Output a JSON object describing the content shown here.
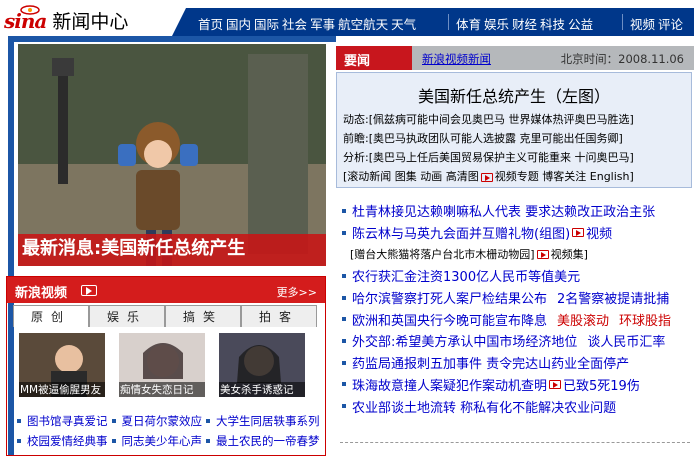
{
  "brand": {
    "logo": "sina",
    "section": "新闻中心"
  },
  "nav": {
    "group1": [
      "首页",
      "国内",
      "国际",
      "社会",
      "军事",
      "航空航天",
      "天气"
    ],
    "group2": [
      "体育",
      "娱乐",
      "财经",
      "科技",
      "公益"
    ],
    "group3": [
      "视频",
      "评论"
    ]
  },
  "hero": {
    "caption": "最新消息:美国新任总统产生"
  },
  "video": {
    "title": "新浪视频",
    "more": "更多>>",
    "tabs": [
      "原创",
      "娱乐",
      "搞笑",
      "拍客"
    ],
    "thumbs": [
      "MM被逼偷腥男友",
      "痴情女失恋日记",
      "美女杀手诱惑记"
    ],
    "links": [
      [
        "图书馆寻真爱记",
        "夏日荷尔蒙效应",
        "大学生同居轶事系列"
      ],
      [
        "校园爱情经典事",
        "同志美少年心声",
        "最土农民的一帝春梦"
      ]
    ]
  },
  "news_header": {
    "label": "要闻",
    "link": "新浪视频新闻",
    "time": "北京时间：2008.11.06"
  },
  "topbox": {
    "title": "美国新任总统产生（左图）",
    "rows": [
      "动态:[佩兹病可能中间会见奥巴马 世界媒体热评奥巴马胜选]",
      "前瞻:[奥巴马执政团队可能人选披露 克里可能出任国务卿]",
      "分析:[奥巴马上任后美国贸易保护主义可能重来 十问奥巴马]",
      "[滚动新闻 图集 动画 高清图",
      "视频专题 博客关注 English]"
    ]
  },
  "headlines": [
    "杜青林接见达赖喇嘛私人代表 要求达赖改正政治主张",
    "陈云林与马英九会面并互赠礼物(组图)",
    "视频",
    "[赠台大熊猫将落户台北市木栅动物园]",
    "视频集]",
    "农行获汇金注资1300亿人民币等值美元",
    "哈尔滨警察打死人案尸检结果公布",
    "2名警察被提请批捕",
    "欧洲和英国央行今晚可能宣布降息",
    "美股滚动",
    "环球股指",
    "外交部:希望美方承认中国市场经济地位",
    "谈人民币汇率",
    "药监局通报刺五加事件 责令完达山药业全面停产",
    "珠海故意撞人案疑犯作案动机查明",
    "已致5死19伤",
    "农业部谈土地流转 称私有化不能解决农业问题"
  ],
  "colors": {
    "nav_blue": "#00378a",
    "frame_blue": "#1c56a6",
    "accent_red": "#c8161d",
    "link_blue": "#0000cc"
  }
}
